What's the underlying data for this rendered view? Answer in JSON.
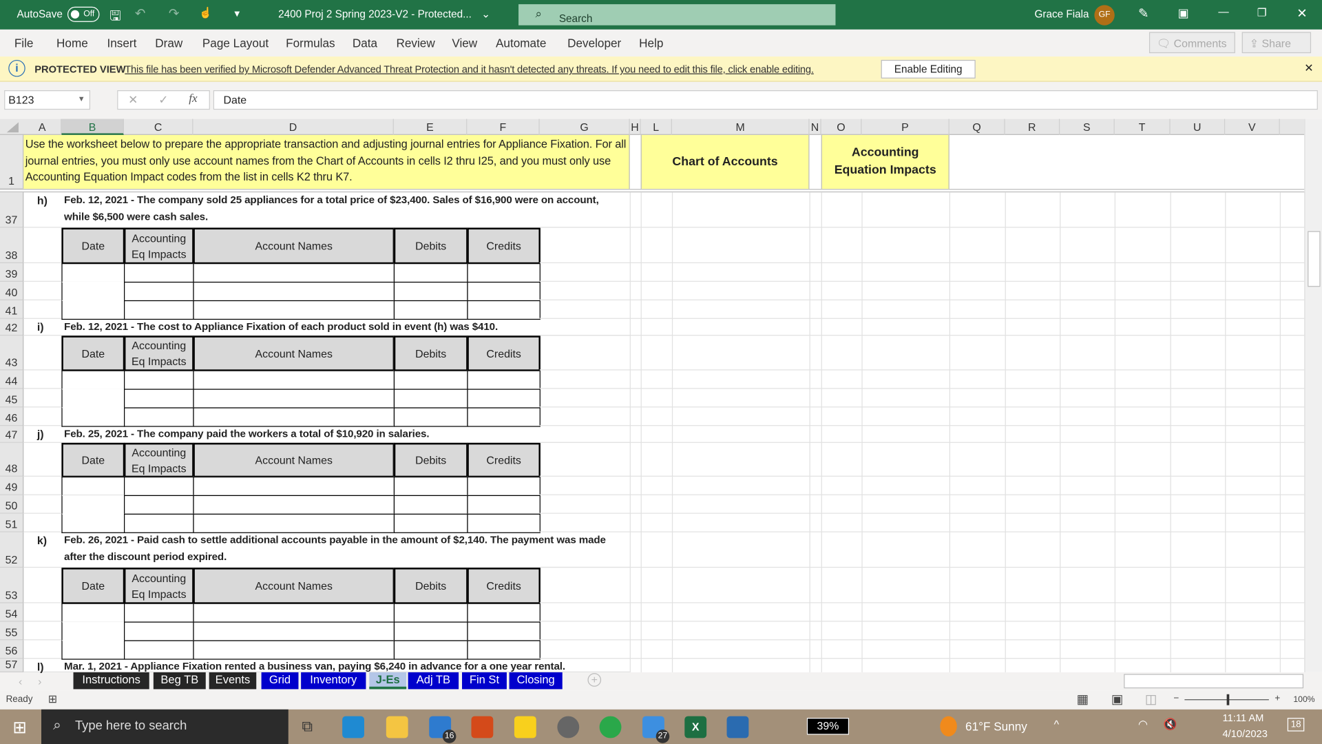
{
  "titlebar": {
    "autosave": "AutoSave",
    "autosave_state": "Off",
    "filename": "2400 Proj 2 Spring 2023-V2  -  Protected...",
    "search_placeholder": "Search",
    "user": "Grace Fiala",
    "initials": "GF"
  },
  "menu": [
    "File",
    "Home",
    "Insert",
    "Draw",
    "Page Layout",
    "Formulas",
    "Data",
    "Review",
    "View",
    "Automate",
    "Developer",
    "Help"
  ],
  "menu_right": {
    "comments": "Comments",
    "share": "Share"
  },
  "protected": {
    "label": "PROTECTED VIEW",
    "message": "This file has been verified by Microsoft Defender Advanced Threat Protection and it hasn't detected any threats. If you need to edit this file, click enable editing.",
    "button": "Enable Editing"
  },
  "formula_bar": {
    "name_box": "B123",
    "fx": "fx",
    "value": "Date"
  },
  "columns": [
    "A",
    "B",
    "C",
    "D",
    "E",
    "F",
    "G",
    "H",
    "L",
    "M",
    "N",
    "O",
    "P",
    "Q",
    "R",
    "S",
    "T",
    "U",
    "V"
  ],
  "selected_column": "B",
  "instructions": "Use the worksheet below to prepare the appropriate transaction and adjusting journal entries for Appliance Fixation. For all journal entries, you must only use account names from the Chart of Accounts in cells I2 thru I25, and you must only use Accounting Equation Impact codes from the list in cells K2 thru K7.",
  "chart_of_accounts": "Chart of Accounts",
  "accounting_equation_impacts": "Accounting Equation Impacts",
  "table_headers": [
    "Date",
    "Accounting Eq Impacts",
    "Account Names",
    "Debits",
    "Credits"
  ],
  "events": [
    {
      "letter": "h)",
      "row": "37",
      "description": "Feb. 12, 2021 - The company sold 25 appliances for a total price of $23,400. Sales of $16,900 were on account, while $6,500 were cash sales.",
      "rows": [
        "38",
        "39",
        "40",
        "41"
      ]
    },
    {
      "letter": "i)",
      "row": "42",
      "description": "Feb. 12, 2021 - The cost to Appliance Fixation of each product sold in event (h) was $410.",
      "rows": [
        "43",
        "44",
        "45",
        "46"
      ]
    },
    {
      "letter": "j)",
      "row": "47",
      "description": "Feb. 25, 2021 - The company paid the workers a total of $10,920 in salaries.",
      "rows": [
        "48",
        "49",
        "50",
        "51"
      ]
    },
    {
      "letter": "k)",
      "row": "52",
      "description": "Feb. 26, 2021 - Paid cash to settle additional accounts payable in the amount of $2,140. The payment was made after the discount period expired.",
      "rows": [
        "53",
        "54",
        "55",
        "56"
      ]
    },
    {
      "letter": "l)",
      "row": "57",
      "description": "Mar. 1, 2021 - Appliance Fixation rented a business van, paying $6,240 in advance for a one year rental."
    }
  ],
  "sheet_tabs": [
    {
      "label": "Instructions",
      "color": "#262626"
    },
    {
      "label": "Beg TB",
      "color": "#262626"
    },
    {
      "label": "Events",
      "color": "#262626"
    },
    {
      "label": "Grid",
      "color": "#0000cc"
    },
    {
      "label": "Inventory",
      "color": "#0000cc"
    },
    {
      "label": "J-Es",
      "color": "#b4c6e7",
      "active": true
    },
    {
      "label": "Adj TB",
      "color": "#0000cc"
    },
    {
      "label": "Fin St",
      "color": "#0000cc"
    },
    {
      "label": "Closing",
      "color": "#0000cc"
    }
  ],
  "status": {
    "ready": "Ready",
    "zoom": "100%"
  },
  "taskbar": {
    "search_placeholder": "Type here to search",
    "mail_badge": "16",
    "todo_badge": "27",
    "battery": "39%",
    "weather": "61°F  Sunny",
    "time": "11:11 AM",
    "date": "4/10/2023",
    "notifications": "18"
  }
}
